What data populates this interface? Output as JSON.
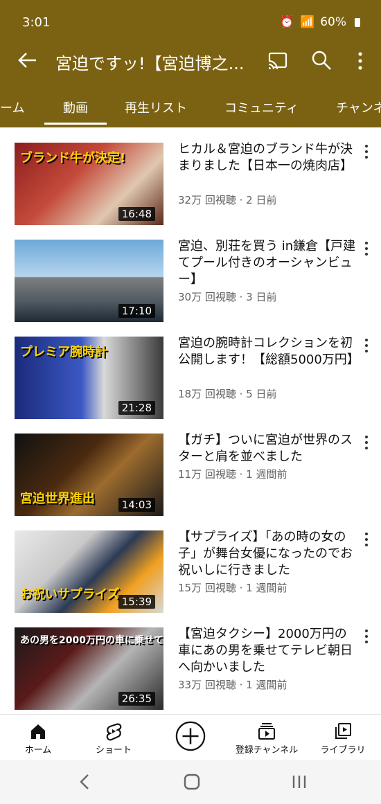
{
  "status": {
    "time": "3:01",
    "battery": "60%"
  },
  "appbar": {
    "title": "宮迫ですッ!【宮迫博之..."
  },
  "tabs": [
    "ーム",
    "動画",
    "再生リスト",
    "コミュニティ",
    "チャンネ"
  ],
  "videos": [
    {
      "title": "ヒカル＆宮迫のブランド牛が決まりました【日本一の焼肉店】",
      "meta": "32万 回視聴 · 2 日前",
      "duration": "16:48",
      "overlay": "ブランド牛が決定!"
    },
    {
      "title": "宮迫、別荘を買う in鎌倉【戸建てプール付きのオーシャンビュー】",
      "meta": "30万 回視聴 · 3 日前",
      "duration": "17:10",
      "overlay": ""
    },
    {
      "title": "宮迫の腕時計コレクションを初公開します！【総額5000万円】",
      "meta": "18万 回視聴 · 5 日前",
      "duration": "21:28",
      "overlay": "プレミア腕時計"
    },
    {
      "title": "【ガチ】ついに宮迫が世界のスターと肩を並べました",
      "meta": "11万 回視聴 · 1 週間前",
      "duration": "14:03",
      "overlay": "宮迫世界進出"
    },
    {
      "title": "【サプライズ】「あの時の女の子」が舞台女優になったのでお祝いしに行きました",
      "meta": "15万 回視聴 · 1 週間前",
      "duration": "15:39",
      "overlay": "お祝いサプライズ"
    },
    {
      "title": "【宮迫タクシー】2000万円の車にあの男を乗せてテレビ朝日へ向かいました",
      "meta": "33万 回視聴 · 1 週間前",
      "duration": "26:35",
      "overlay": "あの男を2000万円の車に乗せて"
    }
  ],
  "bottom_nav": [
    {
      "label": "ホーム",
      "icon": "home-icon"
    },
    {
      "label": "ショート",
      "icon": "shorts-icon"
    },
    {
      "label": "",
      "icon": "create-icon"
    },
    {
      "label": "登録チャンネル",
      "icon": "subscriptions-icon"
    },
    {
      "label": "ライブラリ",
      "icon": "library-icon"
    }
  ],
  "colors": {
    "brand": "#7b6212",
    "text": "#111111",
    "meta": "#606060"
  }
}
